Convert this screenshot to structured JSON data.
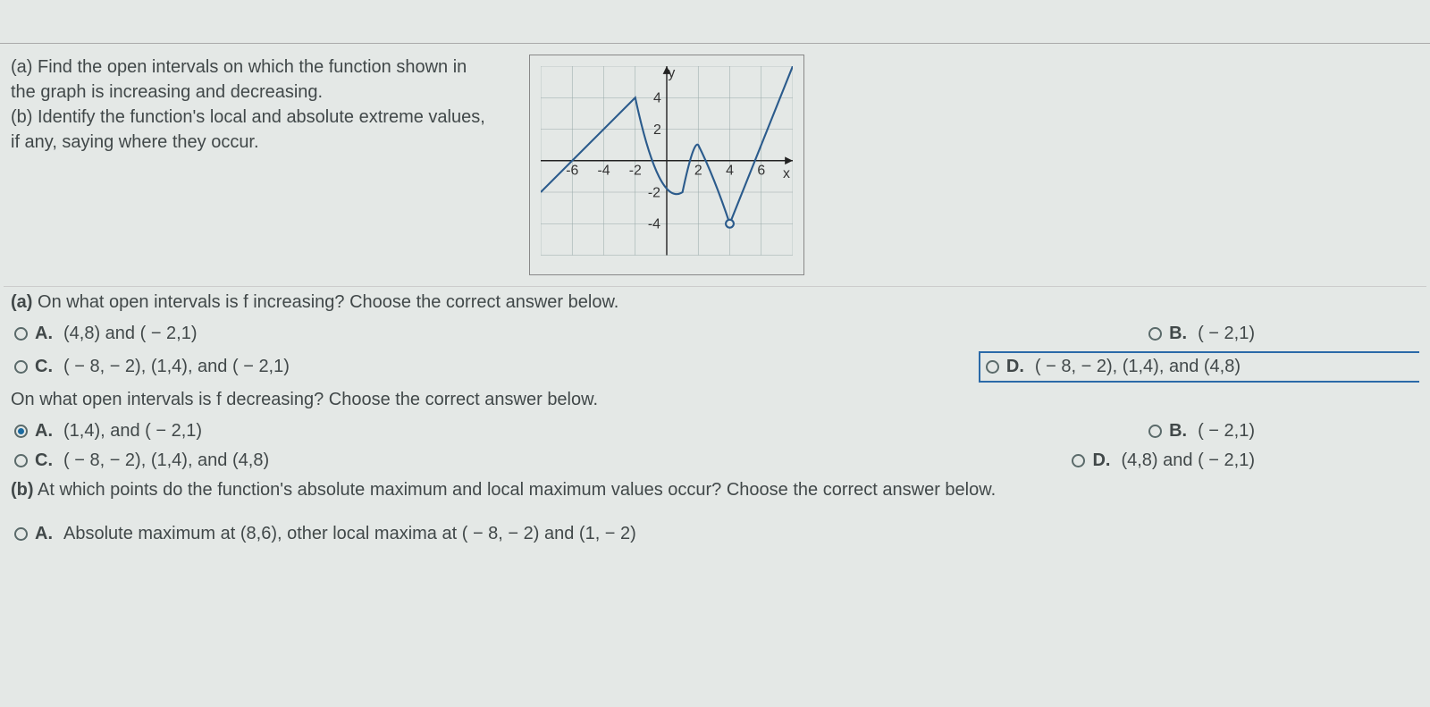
{
  "problem": {
    "part_a": "(a) Find the open intervals on which the function shown in the graph is increasing and decreasing.",
    "part_b": "(b) Identify the function's local and absolute extreme values, if any, saying where they occur."
  },
  "q1": {
    "prompt_label": "(a)",
    "prompt": " On what open intervals is f increasing? Choose the correct answer below.",
    "A": {
      "letter": "A.",
      "text": "(4,8) and ( − 2,1)"
    },
    "B": {
      "letter": "B.",
      "text": "( − 2,1)"
    },
    "C": {
      "letter": "C.",
      "text": "( − 8, − 2), (1,4), and ( − 2,1)"
    },
    "D": {
      "letter": "D.",
      "text": "( − 8, − 2), (1,4), and (4,8)"
    }
  },
  "q2": {
    "prompt": "On what open intervals is f decreasing? Choose the correct answer below.",
    "A": {
      "letter": "A.",
      "text": "(1,4), and ( − 2,1)"
    },
    "B": {
      "letter": "B.",
      "text": "( − 2,1)"
    },
    "C": {
      "letter": "C.",
      "text": "( − 8, − 2), (1,4), and (4,8)"
    },
    "D": {
      "letter": "D.",
      "text": "(4,8) and ( − 2,1)"
    }
  },
  "q3": {
    "prompt_label": "(b)",
    "prompt": " At which points do the function's absolute maximum and local maximum values occur? Choose the correct answer below.",
    "A": {
      "letter": "A.",
      "text": "Absolute maximum at (8,6), other local maxima at ( − 8, − 2) and (1, − 2)"
    }
  },
  "chart_data": {
    "type": "line",
    "title": "",
    "xlabel": "x",
    "ylabel": "y",
    "xlim": [
      -8,
      8
    ],
    "ylim": [
      -6,
      6
    ],
    "x_ticks": [
      -6,
      -4,
      -2,
      2,
      4,
      6
    ],
    "y_ticks": [
      -4,
      -2,
      2,
      4
    ],
    "data_points": [
      {
        "x": -8,
        "y": -2
      },
      {
        "x": -2,
        "y": 4
      },
      {
        "x": 1,
        "y": -2
      },
      {
        "x": 2,
        "y": 1
      },
      {
        "x": 4,
        "y": -4,
        "open": true
      },
      {
        "x": 8,
        "y": 6
      }
    ],
    "notes": "Function increases on (-8,-2), decreases on (-2,1), increases on (1,2) with slight bump, decreases to open circle at (4,-4), then increases to (8,6)."
  }
}
